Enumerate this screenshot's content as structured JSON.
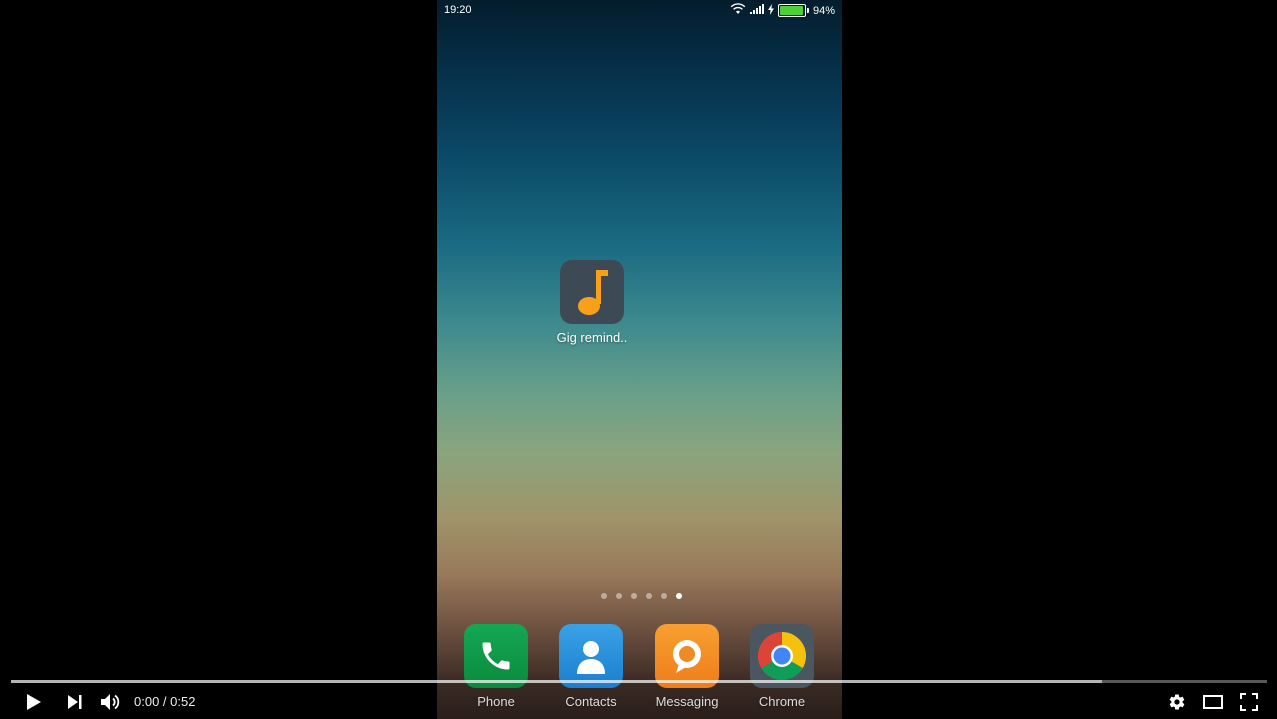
{
  "status_bar": {
    "time": "19:20",
    "battery_percent_label": "94%",
    "battery_level": 0.94
  },
  "home_app": {
    "label": "Gig remind..",
    "icon": "music-note-icon"
  },
  "pager": {
    "count": 6,
    "active_index": 5
  },
  "dock": [
    {
      "label": "Phone",
      "icon": "phone-icon"
    },
    {
      "label": "Contacts",
      "icon": "contacts-icon"
    },
    {
      "label": "Messaging",
      "icon": "message-bubble-icon"
    },
    {
      "label": "Chrome",
      "icon": "chrome-icon"
    }
  ],
  "player": {
    "current_time": "0:00",
    "separator": " / ",
    "duration": "0:52",
    "played_fraction": 0.0,
    "loaded_fraction": 0.869,
    "accent_color": "#ff0000"
  }
}
